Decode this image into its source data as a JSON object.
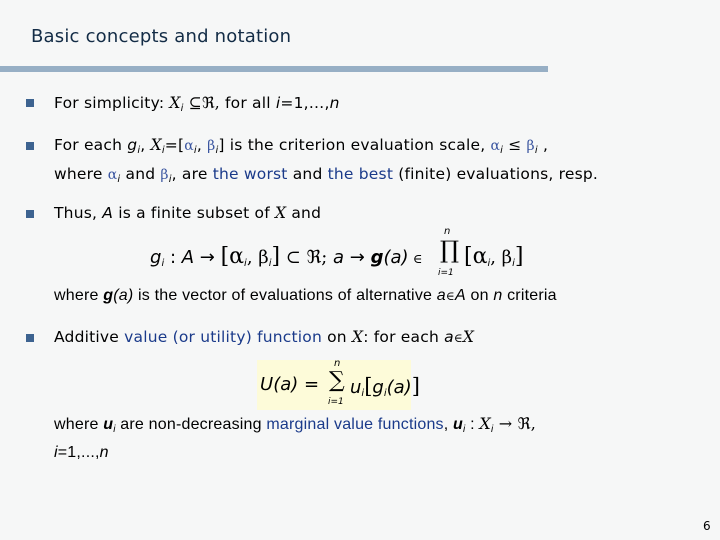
{
  "slide": {
    "title": "Basic concepts and notation",
    "page_number": "6",
    "colors": {
      "title": "#132c46",
      "rule": "#97afc5",
      "bullet": "#3d6390",
      "highlight_text": "#1a3a8a",
      "formula_bg": "#fdfbd9"
    }
  },
  "bullets": [
    {
      "parts": {
        "a": "For simplicity:  ",
        "X": "X",
        "i": "i",
        "subset": " ⊆ℜ, ",
        "b": "for all ",
        "ieq": "i",
        "c": "=1,…,",
        "n": "n"
      }
    },
    {
      "line1": {
        "a": "For each ",
        "g": "g",
        "i": "i",
        "b": ",  ",
        "X": "X",
        "i2": "i",
        "c": "=[",
        "alpha": "α",
        "i3": "i",
        "d": ", ",
        "beta": "β",
        "i4": "i",
        "e": "] is the criterion evaluation scale, ",
        "alpha2": "α",
        "i5": "i",
        "leq": " ≤ ",
        "beta2": "β",
        "i6": "i",
        "f": " ,"
      },
      "line2": {
        "a": "where ",
        "alpha": "α",
        "i": "i",
        "b": " and ",
        "beta": "β",
        "i2": "i",
        "c": ", are ",
        "worst": "the worst",
        "d": " and ",
        "best": "the best",
        "e": " (finite) evaluations, resp."
      }
    },
    {
      "line1": {
        "a": "Thus, ",
        "A": "A",
        "b": " is a finite subset of ",
        "X": "X",
        "c": " and"
      },
      "formula": {
        "g": "g",
        "i": "i",
        "map": " : ",
        "A": "A",
        "arrow": " → ",
        "interval": "[α",
        "i2": "i",
        "comma": ", β",
        "i3": "i",
        "close": "]",
        "subsetR": " ⊂ ℜ;  ",
        "a": "a",
        "arrow2": " → ",
        "gbold": "g",
        "arg": "(a)",
        "in": " ∈ ",
        "prod": "∏",
        "prod_top": "n",
        "prod_bottom": "i=1",
        "interval2": "[α",
        "i4": "i",
        "comma2": ", β",
        "i5": "i",
        "close2": "]"
      },
      "line2": {
        "a": "where ",
        "gbold": "g",
        "arg": "(a)",
        "b": " is the vector of evaluations of alternative ",
        "a2": "a",
        "in": "∈",
        "A": "A",
        "c": " on ",
        "n": "n",
        "d": " criteria"
      }
    },
    {
      "line1": {
        "a": "Additive ",
        "hl": "value (or utility) function",
        "b": " on ",
        "X": "X",
        "c": ": for each ",
        "a2": "a",
        "in": "∈",
        "X2": "X"
      },
      "formula": {
        "U": "U",
        "arg": "(a)",
        "eq": " = ",
        "sum": "∑",
        "sum_top": "n",
        "sum_bottom": "i=1",
        "u": "u",
        "i": "i",
        "open": "[",
        "g": "g",
        "i2": "i",
        "arg2": "(a)",
        "close": "]"
      },
      "line2": {
        "a": "where ",
        "u": "u",
        "i": "i",
        "b": " are non-decreasing ",
        "hl": "marginal value functions",
        "c": ", ",
        "u2": "u",
        "i2": "i",
        "d": " : ",
        "X": "X",
        "i3": "i",
        "e": " → ℜ,"
      },
      "line3": {
        "i": "i",
        "a": "=1,...,",
        "n": "n"
      }
    }
  ]
}
